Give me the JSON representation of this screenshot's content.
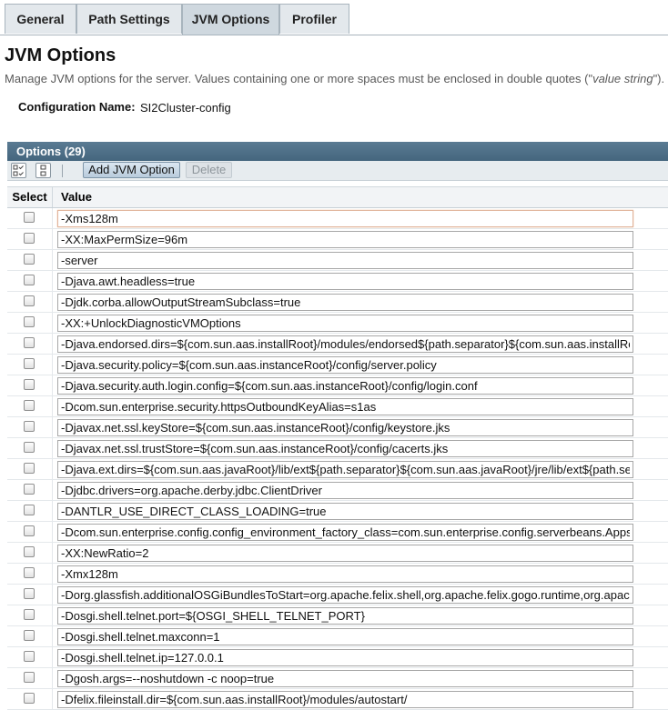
{
  "tabs": [
    "General",
    "Path Settings",
    "JVM Options",
    "Profiler"
  ],
  "active_tab": 2,
  "page": {
    "title": "JVM Options",
    "help_prefix": "Manage JVM options for the server. Values containing one or more spaces must be enclosed in double quotes (\"",
    "help_em": "value string",
    "help_suffix": "\").",
    "config_label": "Configuration Name:",
    "config_value": "SI2Cluster-config"
  },
  "table": {
    "title": "Options (29)",
    "select_all_icon": "select-all-icon",
    "deselect_all_icon": "deselect-all-icon",
    "add_label": "Add JVM Option",
    "delete_label": "Delete",
    "col_select": "Select",
    "col_value": "Value",
    "rows": [
      "-Xms128m",
      "-XX:MaxPermSize=96m",
      "-server",
      "-Djava.awt.headless=true",
      "-Djdk.corba.allowOutputStreamSubclass=true",
      "-XX:+UnlockDiagnosticVMOptions",
      "-Djava.endorsed.dirs=${com.sun.aas.installRoot}/modules/endorsed${path.separator}${com.sun.aas.installRoo",
      "-Djava.security.policy=${com.sun.aas.instanceRoot}/config/server.policy",
      "-Djava.security.auth.login.config=${com.sun.aas.instanceRoot}/config/login.conf",
      "-Dcom.sun.enterprise.security.httpsOutboundKeyAlias=s1as",
      "-Djavax.net.ssl.keyStore=${com.sun.aas.instanceRoot}/config/keystore.jks",
      "-Djavax.net.ssl.trustStore=${com.sun.aas.instanceRoot}/config/cacerts.jks",
      "-Djava.ext.dirs=${com.sun.aas.javaRoot}/lib/ext${path.separator}${com.sun.aas.javaRoot}/jre/lib/ext${path.sepa",
      "-Djdbc.drivers=org.apache.derby.jdbc.ClientDriver",
      "-DANTLR_USE_DIRECT_CLASS_LOADING=true",
      "-Dcom.sun.enterprise.config.config_environment_factory_class=com.sun.enterprise.config.serverbeans.Appse",
      "-XX:NewRatio=2",
      "-Xmx128m",
      "-Dorg.glassfish.additionalOSGiBundlesToStart=org.apache.felix.shell,org.apache.felix.gogo.runtime,org.apache",
      "-Dosgi.shell.telnet.port=${OSGI_SHELL_TELNET_PORT}",
      "-Dosgi.shell.telnet.maxconn=1",
      "-Dosgi.shell.telnet.ip=127.0.0.1",
      "-Dgosh.args=--noshutdown -c noop=true",
      "-Dfelix.fileinstall.dir=${com.sun.aas.installRoot}/modules/autostart/"
    ]
  }
}
